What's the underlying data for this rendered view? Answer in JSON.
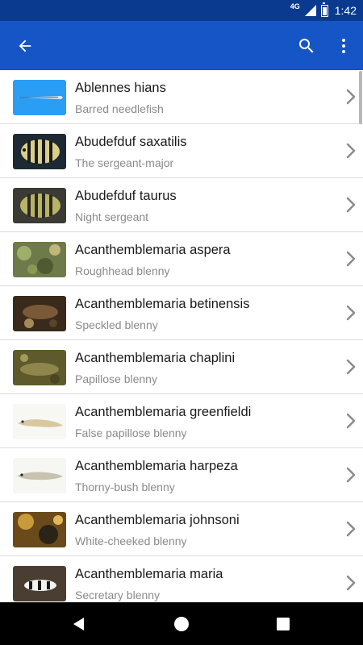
{
  "status_bar": {
    "network": "4G",
    "time": "1:42",
    "battery_level": 0.7,
    "icons": [
      "signal-icon",
      "battery-icon"
    ]
  },
  "app_bar": {
    "color": "#1655c6",
    "icons": [
      "back-arrow-icon",
      "search-icon",
      "more-vert-icon"
    ]
  },
  "species": [
    {
      "scientific": "Ablennes hians",
      "common": "Barred needlefish",
      "thumb": "needlefish"
    },
    {
      "scientific": "Abudefduf saxatilis",
      "common": "The sergeant-major",
      "thumb": "sergeant"
    },
    {
      "scientific": "Abudefduf taurus",
      "common": "Night sergeant",
      "thumb": "sergeant-dark"
    },
    {
      "scientific": "Acanthemblemaria aspera",
      "common": "Roughhead blenny",
      "thumb": "reef-green"
    },
    {
      "scientific": "Acanthemblemaria betinensis",
      "common": "Speckled blenny",
      "thumb": "reef-brown"
    },
    {
      "scientific": "Acanthemblemaria chaplini",
      "common": "Papillose blenny",
      "thumb": "reef-olive"
    },
    {
      "scientific": "Acanthemblemaria greenfieldi",
      "common": "False papillose blenny",
      "thumb": "white-specimen"
    },
    {
      "scientific": "Acanthemblemaria harpeza",
      "common": "Thorny-bush blenny",
      "thumb": "white-specimen-2"
    },
    {
      "scientific": "Acanthemblemaria johnsoni",
      "common": "White-cheeked blenny",
      "thumb": "reef-gold"
    },
    {
      "scientific": "Acanthemblemaria maria",
      "common": "Secretary blenny",
      "thumb": "reef-dark"
    }
  ],
  "nav_bar": {
    "icons": [
      "nav-back-icon",
      "nav-home-icon",
      "nav-recent-icon"
    ]
  }
}
